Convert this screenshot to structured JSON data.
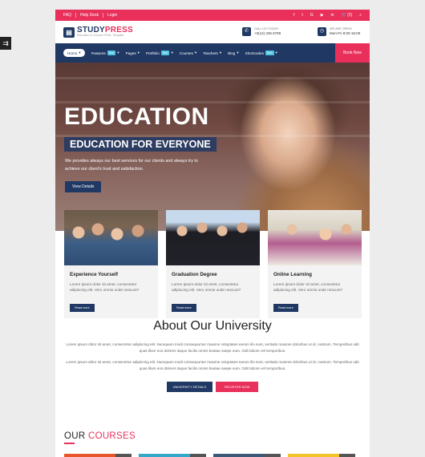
{
  "side_toggle": {
    "label": "⇉"
  },
  "topbar": {
    "links": [
      "FAQ",
      "Help Desk",
      "Login"
    ],
    "social_icons": [
      "facebook-icon",
      "twitter-icon",
      "google-plus-icon",
      "youtube-icon",
      "linkedin-icon"
    ],
    "social_glyphs": [
      "f",
      "t",
      "G",
      "▶",
      "in"
    ],
    "cart": "🛒 (2)",
    "search_glyph": "⌕"
  },
  "header": {
    "logo_study": "STUDY",
    "logo_press": "PRESS",
    "logo_tagline": "Education & Courses HTML Template",
    "call": {
      "label": "CALL US TODAY!",
      "value": "+0(12) 345 6789",
      "icon": "phone-icon",
      "glyph": "✆"
    },
    "open": {
      "label": "WE ARE OPEN!",
      "value": "Mon-Fri 8:00-16:00",
      "icon": "clock-icon",
      "glyph": "◷"
    }
  },
  "nav": {
    "home": "Home",
    "items": [
      {
        "label": "Features",
        "badge": "New"
      },
      {
        "label": "Pages",
        "badge": ""
      },
      {
        "label": "Portfolio",
        "badge": "New"
      },
      {
        "label": "Courses",
        "badge": ""
      },
      {
        "label": "Teachers",
        "badge": ""
      },
      {
        "label": "Blog",
        "badge": ""
      },
      {
        "label": "Shortcodes",
        "badge": "New"
      }
    ],
    "book_now": "Book Now"
  },
  "hero": {
    "title": "EDUCATION",
    "subtitle": "EDUCATION FOR EVERYONE",
    "description": "We provides always our best services for our clients and always try to achieve our client's trust and satisfaction.",
    "button": "View Details"
  },
  "features": [
    {
      "title": "Experience Yourself",
      "text": "Lorem ipsum dolor sit amet, consectetur adipiscing elit. Vero omnis unde nescunt?",
      "button": "Read more"
    },
    {
      "title": "Graduation Degree",
      "text": "Lorem ipsum dolor sit amet, consectetur adipiscing elit. Vero omnis unde nescunt?",
      "button": "Read more"
    },
    {
      "title": "Online Learning",
      "text": "Lorem ipsum dolor sit amet, consectetur adipiscing elit. Vero omnis unde nescunt?",
      "button": "Read more"
    }
  ],
  "about": {
    "title": "About Our University",
    "p1": "Lorem ipsum dolor sit amet, consectetur adipiscing elit. Numquam modi consequuntur maxime voluptates earum illo sunt, veritatis maiores doloribus ut id, nostrum. Temporibus odit quas illum eos dolores itaque facilis omnis beatae saepe eum. Odit labore vel temporibus.",
    "p2": "Lorem ipsum dolor sit amet, consectetur adipiscing elit. Numquam modi consequuntur maxime voluptates earum illo sunt, veritatis maiores doloribus ut id, nostrum. Temporibus odit quas illum eos dolores itaque facilis omnis beatae saepe eum. Odit labore vel temporibus.",
    "button_details": "UNIVERSITY DETAILS",
    "button_register": "REGISTER NOW"
  },
  "courses": {
    "title_our": "OUR",
    "title_courses": "COURSES"
  },
  "colors": {
    "brand_pink": "#e8305b",
    "brand_navy": "#203864",
    "badge": "#4fc3e0"
  }
}
